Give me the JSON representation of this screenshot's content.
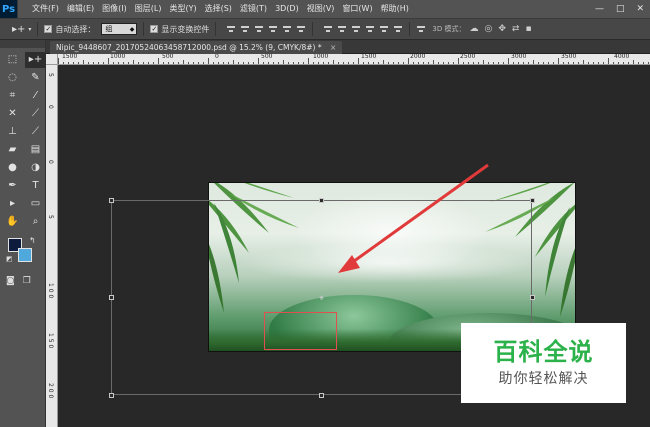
{
  "app": {
    "logo": "Ps"
  },
  "menu": [
    "文件(F)",
    "编辑(E)",
    "图像(I)",
    "图层(L)",
    "类型(Y)",
    "选择(S)",
    "滤镜(T)",
    "3D(D)",
    "视图(V)",
    "窗口(W)",
    "帮助(H)"
  ],
  "window_controls": {
    "minimize": "—",
    "maximize": "□",
    "close": "✕"
  },
  "options": {
    "tool_icon": "▸+",
    "auto_select_label": "自动选择：",
    "auto_select_value": "组",
    "show_transform_label": "显示变换控件",
    "mode_3d_label": "3D 模式："
  },
  "document": {
    "tab_title": "Nipic_9448607_20170524063458712000.psd @ 15.2% (9, CMYK/8#) *",
    "close": "×"
  },
  "ruler": {
    "top_labels": [
      "1500",
      "1000",
      "500",
      "0",
      "500",
      "1000",
      "1500",
      "2000",
      "2500",
      "3000",
      "3500",
      "4000"
    ],
    "left_labels": [
      "5",
      "0",
      "0",
      "5",
      "1 0 0",
      "1 5 0",
      "2 0 0"
    ]
  },
  "tools": [
    "move-tool",
    "artboard-tool",
    "marquee-tool",
    "lasso-tool",
    "quick-select-tool",
    "crop-tool",
    "eyedropper-tool",
    "healing-tool",
    "brush-tool",
    "stamp-tool",
    "history-brush-tool",
    "eraser-tool",
    "gradient-tool",
    "blur-tool",
    "dodge-tool",
    "pen-tool",
    "type-tool",
    "path-select-tool",
    "rectangle-tool",
    "hand-tool",
    "zoom-tool"
  ],
  "colors": {
    "foreground": "#0d1b3d",
    "background": "#4fa9dd",
    "annotation_red": "#e03a3a",
    "watermark_green": "#2cb24a"
  },
  "watermark": {
    "title": "百科全说",
    "subtitle": "助你轻松解决"
  }
}
